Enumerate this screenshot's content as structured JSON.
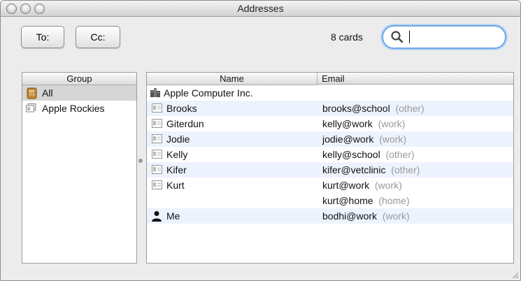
{
  "window": {
    "title": "Addresses"
  },
  "toolbar": {
    "to_label": "To:",
    "cc_label": "Cc:",
    "cards_count": "8 cards",
    "search_value": ""
  },
  "groups": {
    "header": "Group",
    "items": [
      {
        "label": "All",
        "selected": true,
        "icon": "address-book-icon"
      },
      {
        "label": "Apple Rockies",
        "selected": false,
        "icon": "group-cards-icon"
      }
    ]
  },
  "contacts": {
    "headers": {
      "name": "Name",
      "email": "Email"
    },
    "rows": [
      {
        "name": "Apple Computer Inc.",
        "email": "",
        "email_type": "",
        "icon": "company-building-icon"
      },
      {
        "name": "Brooks",
        "email": "brooks@school",
        "email_type": "(other)",
        "icon": "card-icon"
      },
      {
        "name": "Giterdun",
        "email": "kelly@work",
        "email_type": "(work)",
        "icon": "card-icon"
      },
      {
        "name": "Jodie",
        "email": "jodie@work",
        "email_type": "(work)",
        "icon": "card-icon"
      },
      {
        "name": "Kelly",
        "email": "kelly@school",
        "email_type": "(other)",
        "icon": "card-icon"
      },
      {
        "name": "Kifer",
        "email": "kifer@vetclinic",
        "email_type": "(other)",
        "icon": "card-icon"
      },
      {
        "name": "Kurt",
        "email": "kurt@work",
        "email_type": "(work)",
        "icon": "card-icon"
      },
      {
        "name": "",
        "email": "kurt@home",
        "email_type": "(home)",
        "icon": ""
      },
      {
        "name": "Me",
        "email": "bodhi@work",
        "email_type": "(work)",
        "icon": "me-person-icon"
      }
    ]
  },
  "colors": {
    "alt_row": "#edf3fe",
    "selected_group": "#d6d6d6",
    "search_focus": "#6ea8e8",
    "secondary_text": "#9a9a9a"
  }
}
